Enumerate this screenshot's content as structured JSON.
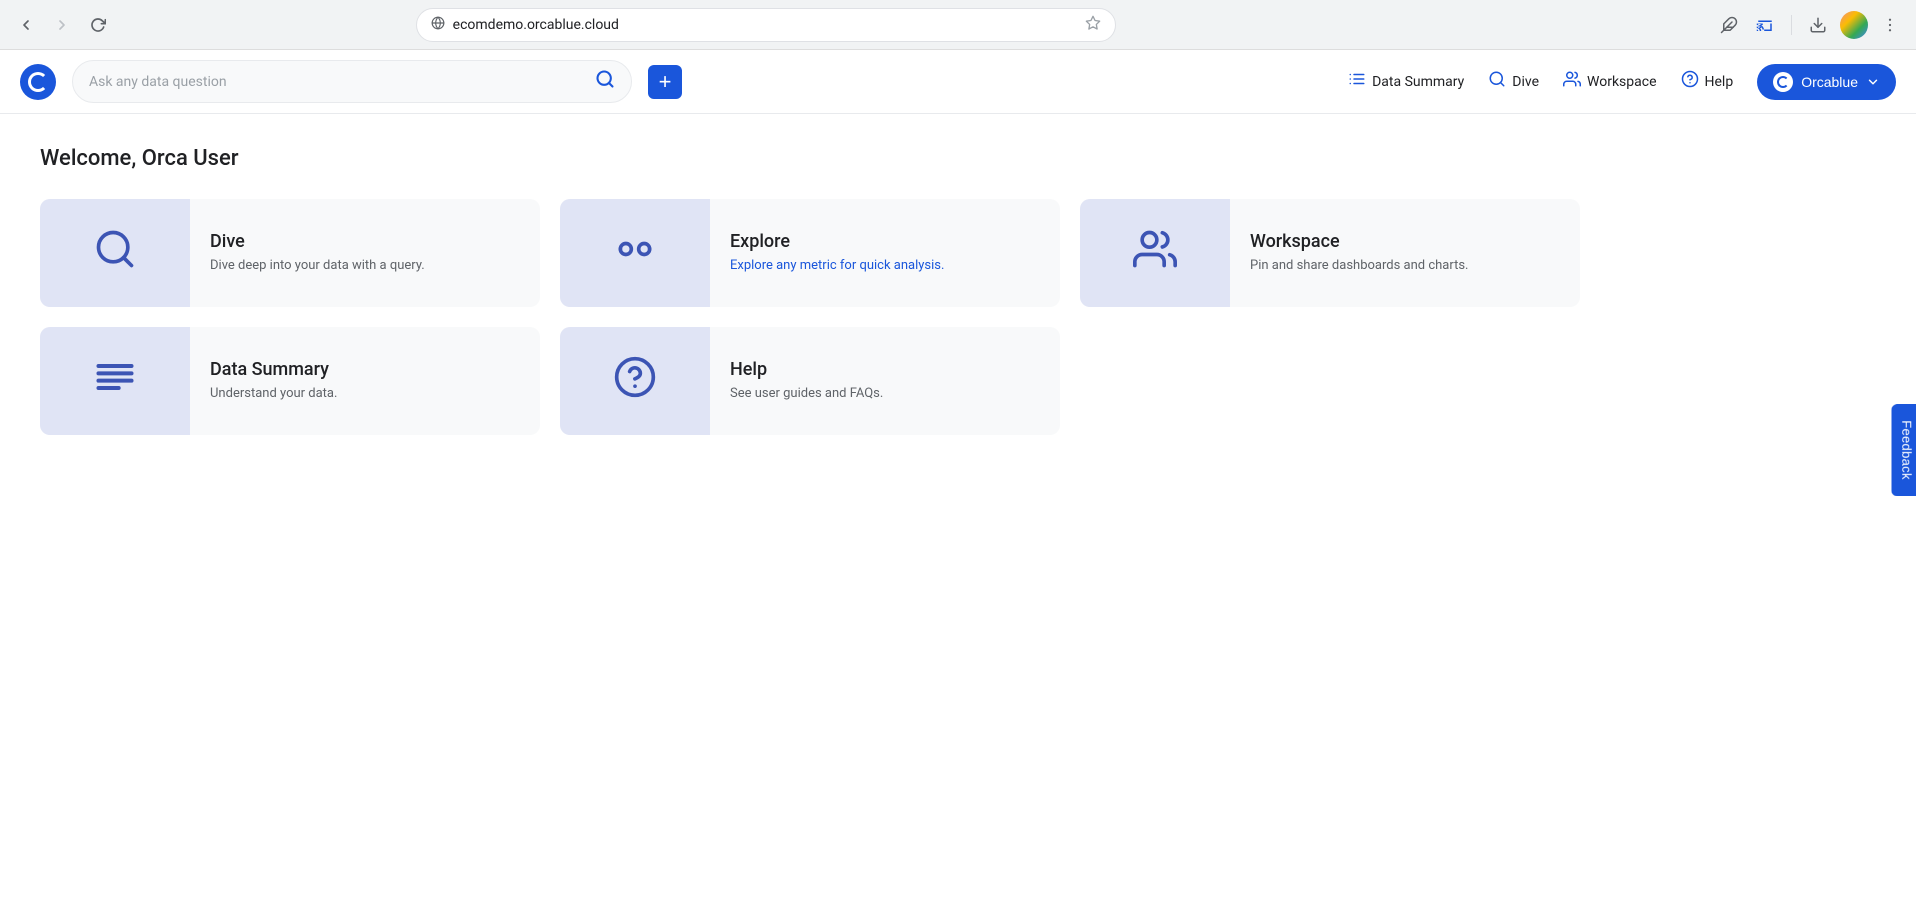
{
  "browser": {
    "url": "ecomdemo.orcablue.cloud",
    "back_disabled": false,
    "forward_disabled": true
  },
  "header": {
    "logo_alt": "Orcablue logo",
    "search_placeholder": "Ask any data question",
    "add_button_label": "+",
    "nav": [
      {
        "id": "data-summary",
        "label": "Data Summary",
        "icon": "data-summary-icon"
      },
      {
        "id": "dive",
        "label": "Dive",
        "icon": "dive-icon"
      },
      {
        "id": "workspace",
        "label": "Workspace",
        "icon": "workspace-icon"
      },
      {
        "id": "help",
        "label": "Help",
        "icon": "help-icon"
      }
    ],
    "brand_button": "Orcablue"
  },
  "main": {
    "welcome": "Welcome, Orca User",
    "cards": [
      {
        "id": "dive",
        "title": "Dive",
        "description": "Dive deep into your data with a query.",
        "desc_blue": false,
        "icon": "search"
      },
      {
        "id": "explore",
        "title": "Explore",
        "description": "Explore any metric for quick analysis.",
        "desc_blue": true,
        "icon": "binoculars"
      },
      {
        "id": "workspace",
        "title": "Workspace",
        "description": "Pin and share dashboards and charts.",
        "desc_blue": false,
        "icon": "workspace"
      },
      {
        "id": "data-summary",
        "title": "Data Summary",
        "description": "Understand your data.",
        "desc_blue": false,
        "icon": "data"
      },
      {
        "id": "help",
        "title": "Help",
        "description": "See user guides and FAQs.",
        "desc_blue": false,
        "icon": "help"
      }
    ]
  },
  "feedback": {
    "label": "Feedback"
  },
  "colors": {
    "brand_blue": "#1a56db",
    "icon_blue": "#3c54b4",
    "icon_bg": "#e0e4f5"
  }
}
